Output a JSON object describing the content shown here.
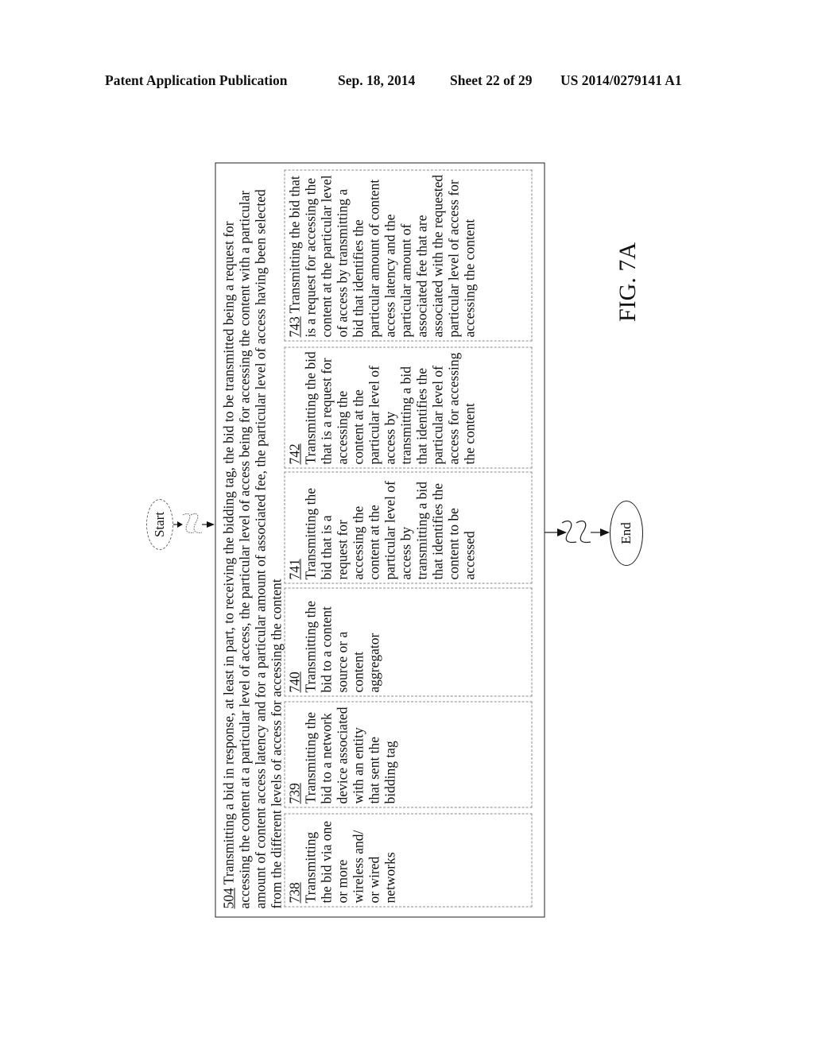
{
  "header": {
    "publication": "Patent Application Publication",
    "date": "Sep. 18, 2014",
    "sheet": "Sheet 22 of 29",
    "number": "US 2014/0279141 A1"
  },
  "diagram": {
    "start_label": "Start",
    "end_label": "End",
    "figure_label": "FIG. 7A",
    "main_step": {
      "ref": "504",
      "text": " Transmitting a bid in response, at least in part, to receiving the bidding tag, the bid to be transmitted being a request for accessing the content at a particular level of access, the particular level of access being for accessing the content with a particular amount of content access latency and for a particular amount of associated fee, the particular level of access having been selected from the different levels of access for accessing the content"
    },
    "sub_steps": [
      {
        "ref": "738",
        "text": "Transmitting the bid via one or more wireless and/ or wired networks"
      },
      {
        "ref": "739",
        "text": "Transmitting the bid to a network device associated with an entity that sent the bidding tag"
      },
      {
        "ref": "740",
        "text": "Transmitting the bid to a content source or a content aggregator"
      },
      {
        "ref": "741",
        "text": "Transmitting the bid that is a request for accessing the content at the particular level of access by transmitting a bid that identifies the content to be accessed"
      },
      {
        "ref": "742",
        "text": "Transmitting the bid that is a request for accessing the content at the particular level of access by transmitting a bid that identifies the particular level of access for accessing the content"
      },
      {
        "ref": "743",
        "text": "Transmitting the bid that is a request for accessing the content at the particular level of access by transmitting a bid that identifies the particular amount of content access latency and the particular amount of associated fee that are associated with the requested particular level of access for accessing the content"
      }
    ]
  }
}
